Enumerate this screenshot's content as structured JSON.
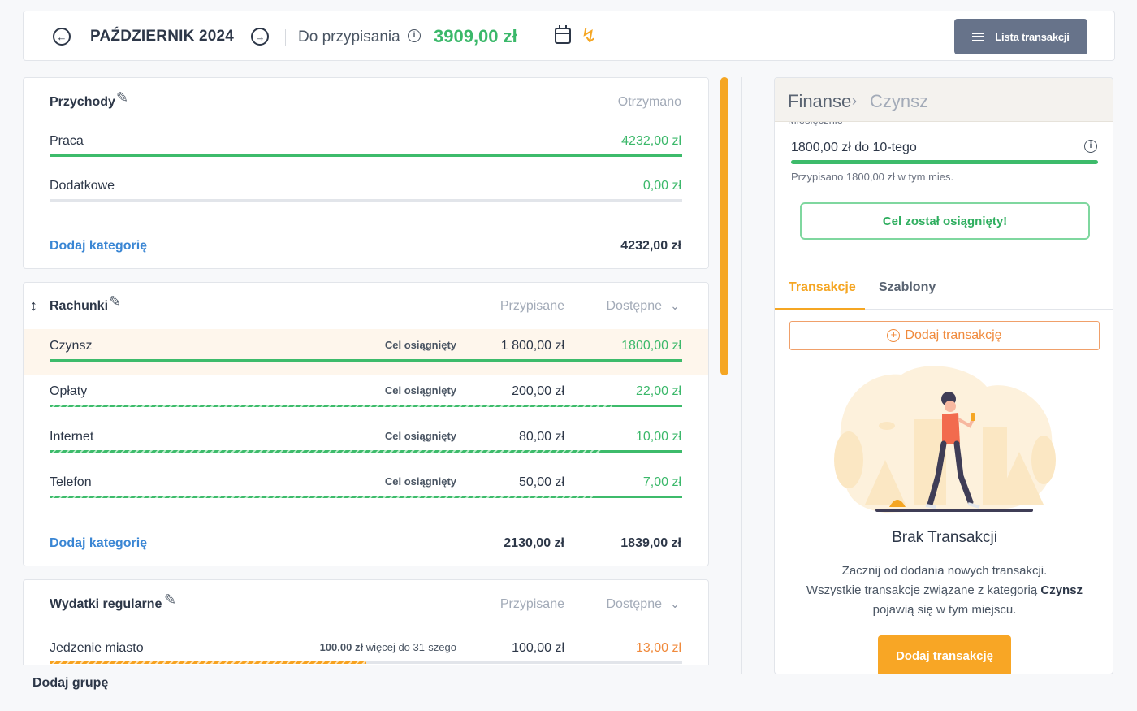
{
  "header": {
    "month": "PAŹDZIERNIK 2024",
    "to_assign_label": "Do przypisania",
    "to_assign_value": "3909,00 zł",
    "transactions_list_label": "Lista transakcji",
    "colors": {
      "positive": "#3bb86a",
      "accent": "#f5a623"
    }
  },
  "income": {
    "title": "Przychody",
    "received_header": "Otrzymano",
    "rows": [
      {
        "name": "Praca",
        "value": "4232,00 zł",
        "fill": 1.0
      },
      {
        "name": "Dodatkowe",
        "value": "0,00 zł",
        "fill": 0.0
      }
    ],
    "add_category": "Dodaj kategorię",
    "total": "4232,00 zł"
  },
  "bills": {
    "title": "Rachunki",
    "assigned_header": "Przypisane",
    "available_header": "Dostępne",
    "rows": [
      {
        "name": "Czynsz",
        "badge": "Cel osiągnięty",
        "assigned": "1 800,00 zł",
        "available": "1800,00 zł",
        "fill": 1.0
      },
      {
        "name": "Opłaty",
        "badge": "Cel osiągnięty",
        "assigned": "200,00 zł",
        "available": "22,00 zł",
        "spent": 0.89
      },
      {
        "name": "Internet",
        "badge": "Cel osiągnięty",
        "assigned": "80,00 zł",
        "available": "10,00 zł",
        "spent": 0.875
      },
      {
        "name": "Telefon",
        "badge": "Cel osiągnięty",
        "assigned": "50,00 zł",
        "available": "7,00 zł",
        "spent": 0.86
      }
    ],
    "add_category": "Dodaj kategorię",
    "total_assigned": "2130,00 zł",
    "total_available": "1839,00 zł"
  },
  "regular": {
    "title": "Wydatki regularne",
    "assigned_header": "Przypisane",
    "available_header": "Dostępne",
    "rows": [
      {
        "name": "Jedzenie miasto",
        "note_amount": "100,00 zł",
        "note_text": "więcej do 31-szego",
        "assigned": "100,00 zł",
        "available": "13,00 zł",
        "spent": 0.5
      }
    ]
  },
  "add_group": "Dodaj grupę",
  "panel": {
    "breadcrumb_root": "Finanse",
    "breadcrumb_current": "Czynsz",
    "monthly_label": "Miesięcznie",
    "goal_text": "1800,00 zł do 10-tego",
    "goal_note": "Przypisano 1800,00 zł w tym mies.",
    "goal_reached": "Cel został osiągnięty!",
    "tabs": [
      "Transakcje",
      "Szablony"
    ],
    "add_transaction_outline": "Dodaj transakcję",
    "empty_title": "Brak Transakcji",
    "empty_line1": "Zacznij od dodania nowych transakcji.",
    "empty_line2_prefix": "Wszystkie transakcje związane z kategorią",
    "empty_line2_category": "Czynsz",
    "empty_line3": "pojawią się w tym miejscu.",
    "add_transaction_button": "Dodaj transakcję"
  }
}
